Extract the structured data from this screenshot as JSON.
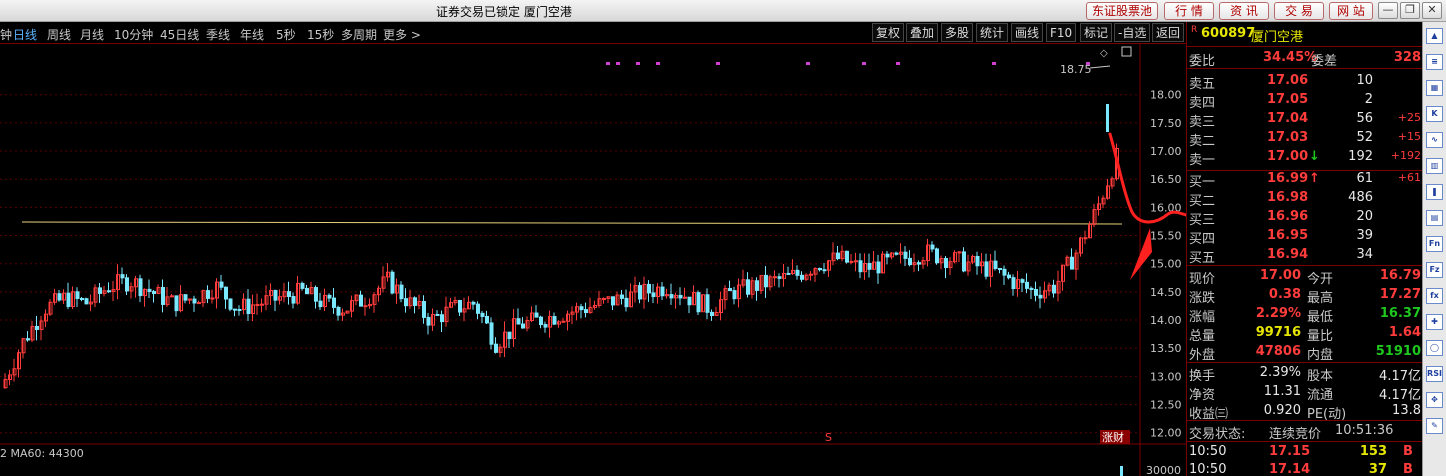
{
  "title": "证券交易已锁定  厦门空港",
  "top_buttons": [
    "东证股票池",
    "行 情",
    "资 讯",
    "交 易",
    "网 站"
  ],
  "periods": [
    "钟",
    "日线",
    "周线",
    "月线",
    "10分钟",
    "45日线",
    "季线",
    "年线",
    "5秒",
    "15秒",
    "多周期",
    "更多 >"
  ],
  "active_period": "日线",
  "tools": [
    "复权",
    "叠加",
    "多股",
    "统计",
    "画线",
    "F10",
    "标记",
    "-自选",
    "返回"
  ],
  "stock": {
    "badge": "R",
    "code": "600897",
    "name": "厦门空港"
  },
  "weibi": {
    "label": "委比",
    "value": "34.45%",
    "label2": "委差",
    "value2": "328"
  },
  "asks": [
    {
      "label": "卖五",
      "price": "17.06",
      "vol": "10",
      "chg": ""
    },
    {
      "label": "卖四",
      "price": "17.05",
      "vol": "2",
      "chg": ""
    },
    {
      "label": "卖三",
      "price": "17.04",
      "vol": "56",
      "chg": "+25"
    },
    {
      "label": "卖二",
      "price": "17.03",
      "vol": "52",
      "chg": "+15"
    },
    {
      "label": "卖一",
      "price": "17.00",
      "vol": "192",
      "chg": "+192",
      "arrow": "↓"
    }
  ],
  "bids": [
    {
      "label": "买一",
      "price": "16.99",
      "vol": "61",
      "chg": "+61",
      "arrow": "↑"
    },
    {
      "label": "买二",
      "price": "16.98",
      "vol": "486",
      "chg": ""
    },
    {
      "label": "买三",
      "price": "16.96",
      "vol": "20",
      "chg": ""
    },
    {
      "label": "买四",
      "price": "16.95",
      "vol": "39",
      "chg": ""
    },
    {
      "label": "买五",
      "price": "16.94",
      "vol": "34",
      "chg": ""
    }
  ],
  "quote": [
    {
      "l1": "现价",
      "v1": "17.00",
      "c1": "red",
      "l2": "今开",
      "v2": "16.79",
      "c2": "red"
    },
    {
      "l1": "涨跌",
      "v1": "0.38",
      "c1": "red",
      "l2": "最高",
      "v2": "17.27",
      "c2": "red"
    },
    {
      "l1": "涨幅",
      "v1": "2.29%",
      "c1": "red",
      "l2": "最低",
      "v2": "16.37",
      "c2": "green"
    },
    {
      "l1": "总量",
      "v1": "99716",
      "c1": "yellow",
      "l2": "量比",
      "v2": "1.64",
      "c2": "red"
    },
    {
      "l1": "外盘",
      "v1": "47806",
      "c1": "red",
      "l2": "内盘",
      "v2": "51910",
      "c2": "green"
    }
  ],
  "fundamentals": [
    {
      "l1": "换手",
      "v1": "2.39%",
      "l2": "股本",
      "v2": "4.17亿"
    },
    {
      "l1": "净资",
      "v1": "11.31",
      "l2": "流通",
      "v2": "4.17亿"
    },
    {
      "l1": "收益㈢",
      "v1": "0.920",
      "l2": "PE(动)",
      "v2": "13.8"
    }
  ],
  "trade_status": {
    "label": "交易状态:",
    "value": "连续竞价",
    "time": "10:51:36"
  },
  "ticks": [
    {
      "time": "10:50",
      "price": "17.15",
      "vol": "153",
      "side": "B"
    },
    {
      "time": "10:50",
      "price": "17.14",
      "vol": "37",
      "side": "B"
    }
  ],
  "sidebar_icons": [
    "up-arrow-icon",
    "list-icon",
    "grid-icon",
    "k-line-icon",
    "trend-icon",
    "bar-icon",
    "candle-icon",
    "chart-icon",
    "fn-icon",
    "fz-icon",
    "fx-icon",
    "cross-icon",
    "circle-icon",
    "rsi-icon",
    "move-icon",
    "pen-icon"
  ],
  "chart_labels": {
    "high_marker": "18.75",
    "ma_text": "2  MA60: 44300",
    "vol_tick": "30000",
    "s_marker": "S",
    "zc_marker": "涨财"
  },
  "chart_data": {
    "type": "candlestick",
    "y_ticks": [
      "18.00",
      "17.50",
      "17.00",
      "16.50",
      "16.00",
      "15.50",
      "15.00",
      "14.50",
      "14.00",
      "13.50",
      "13.00",
      "12.50",
      "12.00"
    ],
    "ylim": [
      11.8,
      18.9
    ],
    "resistance_level": 15.75,
    "high": 18.75
  }
}
